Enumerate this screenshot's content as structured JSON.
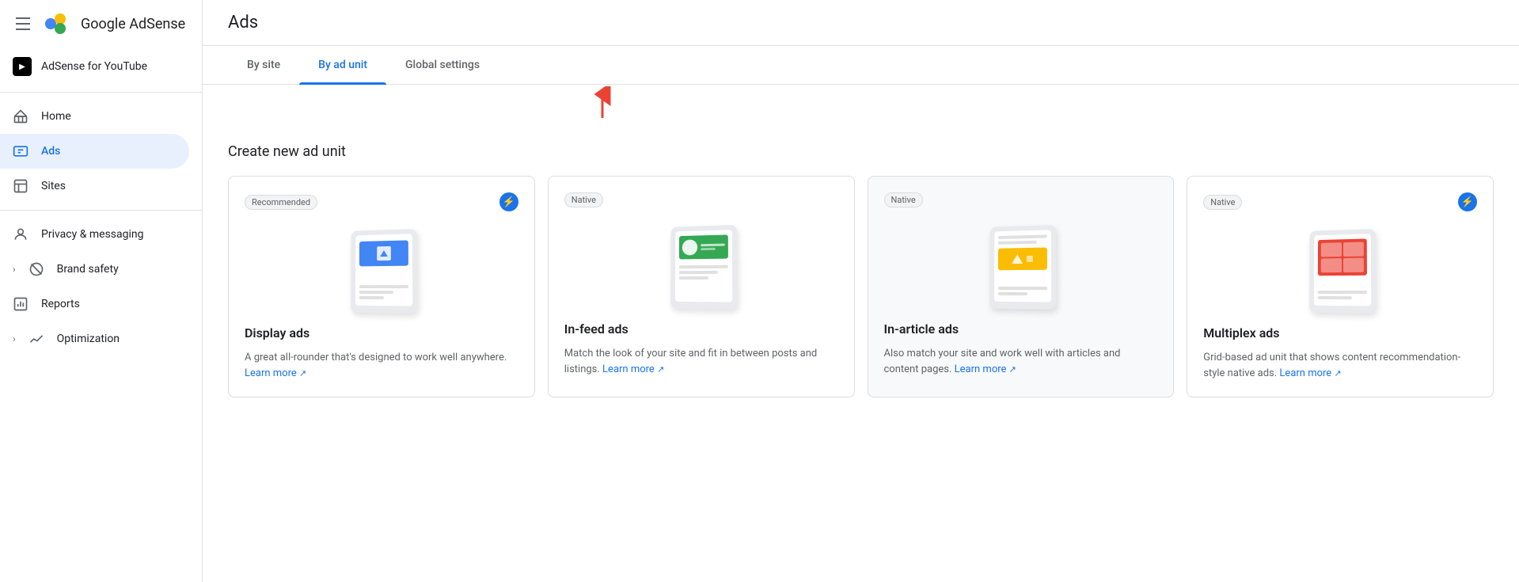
{
  "sidebar": {
    "logo": "Google AdSense",
    "menu_icon_label": "Menu",
    "adsense_youtube": "AdSense for YouTube",
    "items": [
      {
        "id": "home",
        "label": "Home",
        "icon": "home-icon",
        "active": false
      },
      {
        "id": "ads",
        "label": "Ads",
        "icon": "ads-icon",
        "active": true
      },
      {
        "id": "sites",
        "label": "Sites",
        "icon": "sites-icon",
        "active": false
      },
      {
        "id": "privacy-messaging",
        "label": "Privacy & messaging",
        "icon": "privacy-icon",
        "active": false
      },
      {
        "id": "brand-safety",
        "label": "Brand safety",
        "icon": "brand-safety-icon",
        "active": false,
        "expandable": true
      },
      {
        "id": "reports",
        "label": "Reports",
        "icon": "reports-icon",
        "active": false
      },
      {
        "id": "optimization",
        "label": "Optimization",
        "icon": "optimization-icon",
        "active": false,
        "expandable": true
      }
    ]
  },
  "header": {
    "title": "Ads"
  },
  "tabs": [
    {
      "id": "by-site",
      "label": "By site",
      "active": false
    },
    {
      "id": "by-ad-unit",
      "label": "By ad unit",
      "active": true
    },
    {
      "id": "global-settings",
      "label": "Global settings",
      "active": false
    }
  ],
  "content": {
    "section_title": "Create new ad unit",
    "cards": [
      {
        "id": "display-ads",
        "badge": "Recommended",
        "has_lightning": true,
        "title": "Display ads",
        "description": "A great all-rounder that's designed to work well anywhere.",
        "learn_more_label": "Learn more",
        "color": "#4285f4",
        "type": "display"
      },
      {
        "id": "in-feed-ads",
        "badge": "Native",
        "has_lightning": false,
        "title": "In-feed ads",
        "description": "Match the look of your site and fit in between posts and listings.",
        "learn_more_label": "Learn more",
        "color": "#34a853",
        "type": "infeed"
      },
      {
        "id": "in-article-ads",
        "badge": "Native",
        "has_lightning": false,
        "title": "In-article ads",
        "description": "Also match your site and work well with articles and content pages.",
        "learn_more_label": "Learn more",
        "color": "#fbbc04",
        "type": "inarticle"
      },
      {
        "id": "multiplex-ads",
        "badge": "Native",
        "has_lightning": true,
        "title": "Multiplex ads",
        "description": "Grid-based ad unit that shows content recommendation-style native ads.",
        "learn_more_label": "Learn more",
        "color": "#ea4335",
        "type": "multiplex"
      }
    ]
  }
}
